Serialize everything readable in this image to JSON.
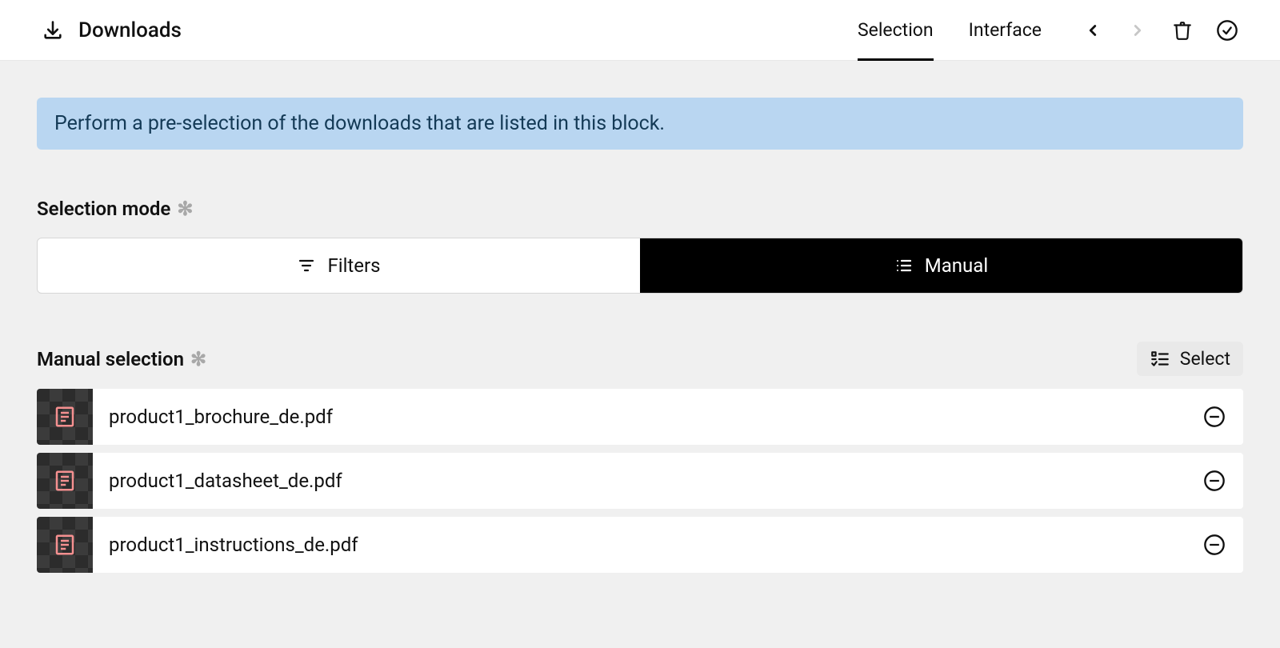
{
  "header": {
    "title": "Downloads",
    "tabs": [
      {
        "label": "Selection",
        "active": true
      },
      {
        "label": "Interface",
        "active": false
      }
    ]
  },
  "banner": {
    "text": "Perform a pre-selection of the downloads that are listed in this block."
  },
  "selection_mode": {
    "label": "Selection mode",
    "options": {
      "filters": "Filters",
      "manual": "Manual"
    }
  },
  "manual_selection": {
    "label": "Manual selection",
    "select_button": "Select",
    "items": [
      {
        "name": "product1_brochure_de.pdf"
      },
      {
        "name": "product1_datasheet_de.pdf"
      },
      {
        "name": "product1_instructions_de.pdf"
      }
    ]
  }
}
